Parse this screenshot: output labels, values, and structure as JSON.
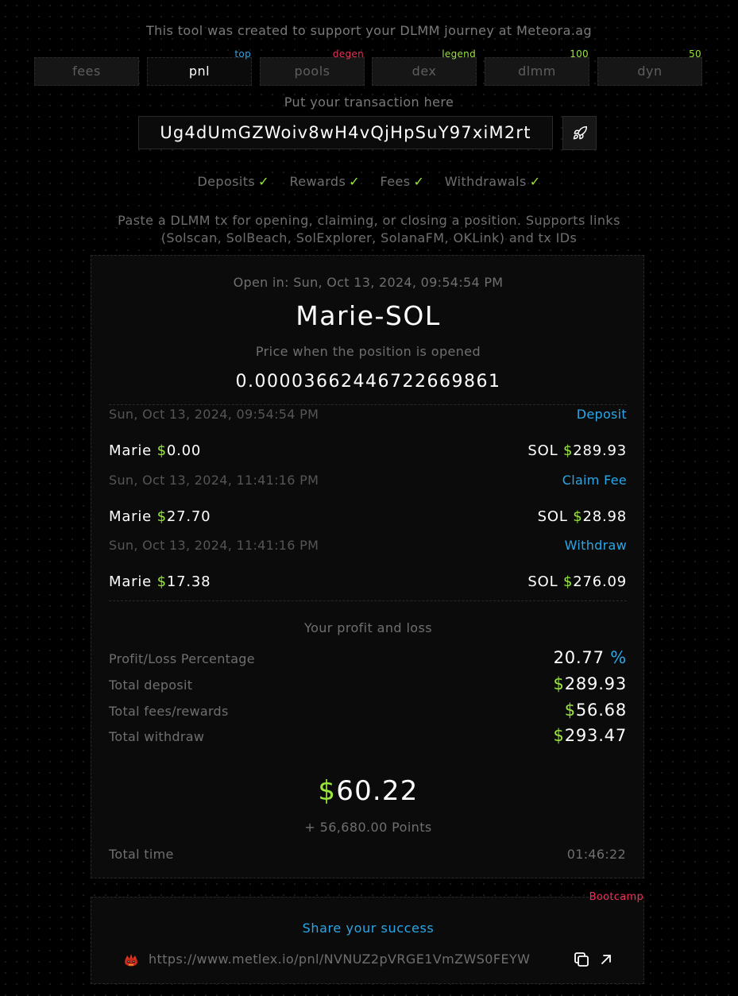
{
  "header": {
    "tagline": "This tool was created to support your DLMM journey at Meteora.ag"
  },
  "tabs": [
    {
      "label": "fees",
      "badge": "",
      "badge_color": ""
    },
    {
      "label": "pnl",
      "badge": "top",
      "badge_color": "#2aa7e8",
      "active": true
    },
    {
      "label": "pools",
      "badge": "degen",
      "badge_color": "#e8325a"
    },
    {
      "label": "dex",
      "badge": "legend",
      "badge_color": "#9ae63c"
    },
    {
      "label": "dlmm",
      "badge": "100",
      "badge_color": "#9ae63c"
    },
    {
      "label": "dyn",
      "badge": "50",
      "badge_color": "#9ae63c"
    }
  ],
  "tx_input": {
    "prompt": "Put your transaction here",
    "value": "Ug4dUmGZWoiv8wH4vQjHpSuY97xiM2rt",
    "submit_icon": "rocket-icon"
  },
  "checks": [
    {
      "label": "Deposits",
      "mark": "✓"
    },
    {
      "label": "Rewards",
      "mark": "✓"
    },
    {
      "label": "Fees",
      "mark": "✓"
    },
    {
      "label": "Withdrawals",
      "mark": "✓"
    }
  ],
  "help_text": "Paste a DLMM tx for opening, claiming, or closing a position. Supports links (Solscan, SolBeach, SolExplorer, SolanaFM, OKLink) and tx IDs",
  "position": {
    "open_in": "Open in: Sun, Oct 13, 2024, 09:54:54 PM",
    "pair": "Marie-SOL",
    "price_label": "Price when the position is opened",
    "price": "0.00003662446722669861"
  },
  "transactions": [
    {
      "date": "Sun, Oct 13, 2024, 09:54:54 PM",
      "kind": "Deposit",
      "token_a": "Marie",
      "amount_a": "0.00",
      "token_b": "SOL",
      "amount_b": "289.93"
    },
    {
      "date": "Sun, Oct 13, 2024, 11:41:16 PM",
      "kind": "Claim Fee",
      "token_a": "Marie",
      "amount_a": "27.70",
      "token_b": "SOL",
      "amount_b": "28.98"
    },
    {
      "date": "Sun, Oct 13, 2024, 11:41:16 PM",
      "kind": "Withdraw",
      "token_a": "Marie",
      "amount_a": "17.38",
      "token_b": "SOL",
      "amount_b": "276.09"
    }
  ],
  "currency_symbol": "$",
  "pnl": {
    "title": "Your profit and loss",
    "pct_label": "Profit/Loss Percentage",
    "pct_value": "20.77",
    "pct_symbol": "%",
    "deposit_label": "Total deposit",
    "deposit_value": "289.93",
    "fees_label": "Total fees/rewards",
    "fees_value": "56.68",
    "withdraw_label": "Total withdraw",
    "withdraw_value": "293.47",
    "total_value": "60.22",
    "points": "+ 56,680.00 Points",
    "time_label": "Total time",
    "time_value": "01:46:22"
  },
  "share": {
    "badge": "Bootcamp",
    "title": "Share your success",
    "link": "https://www.metlex.io/pnl/NVNUZ2pVRGE1VmZWS0FEYW",
    "emoji_icon": "meteor-mascot-icon",
    "copy_icon": "copy-icon",
    "open_icon": "external-link-icon"
  },
  "colors": {
    "accent_blue": "#2aa7e8",
    "accent_green": "#9ae63c",
    "accent_red": "#e8325a"
  }
}
